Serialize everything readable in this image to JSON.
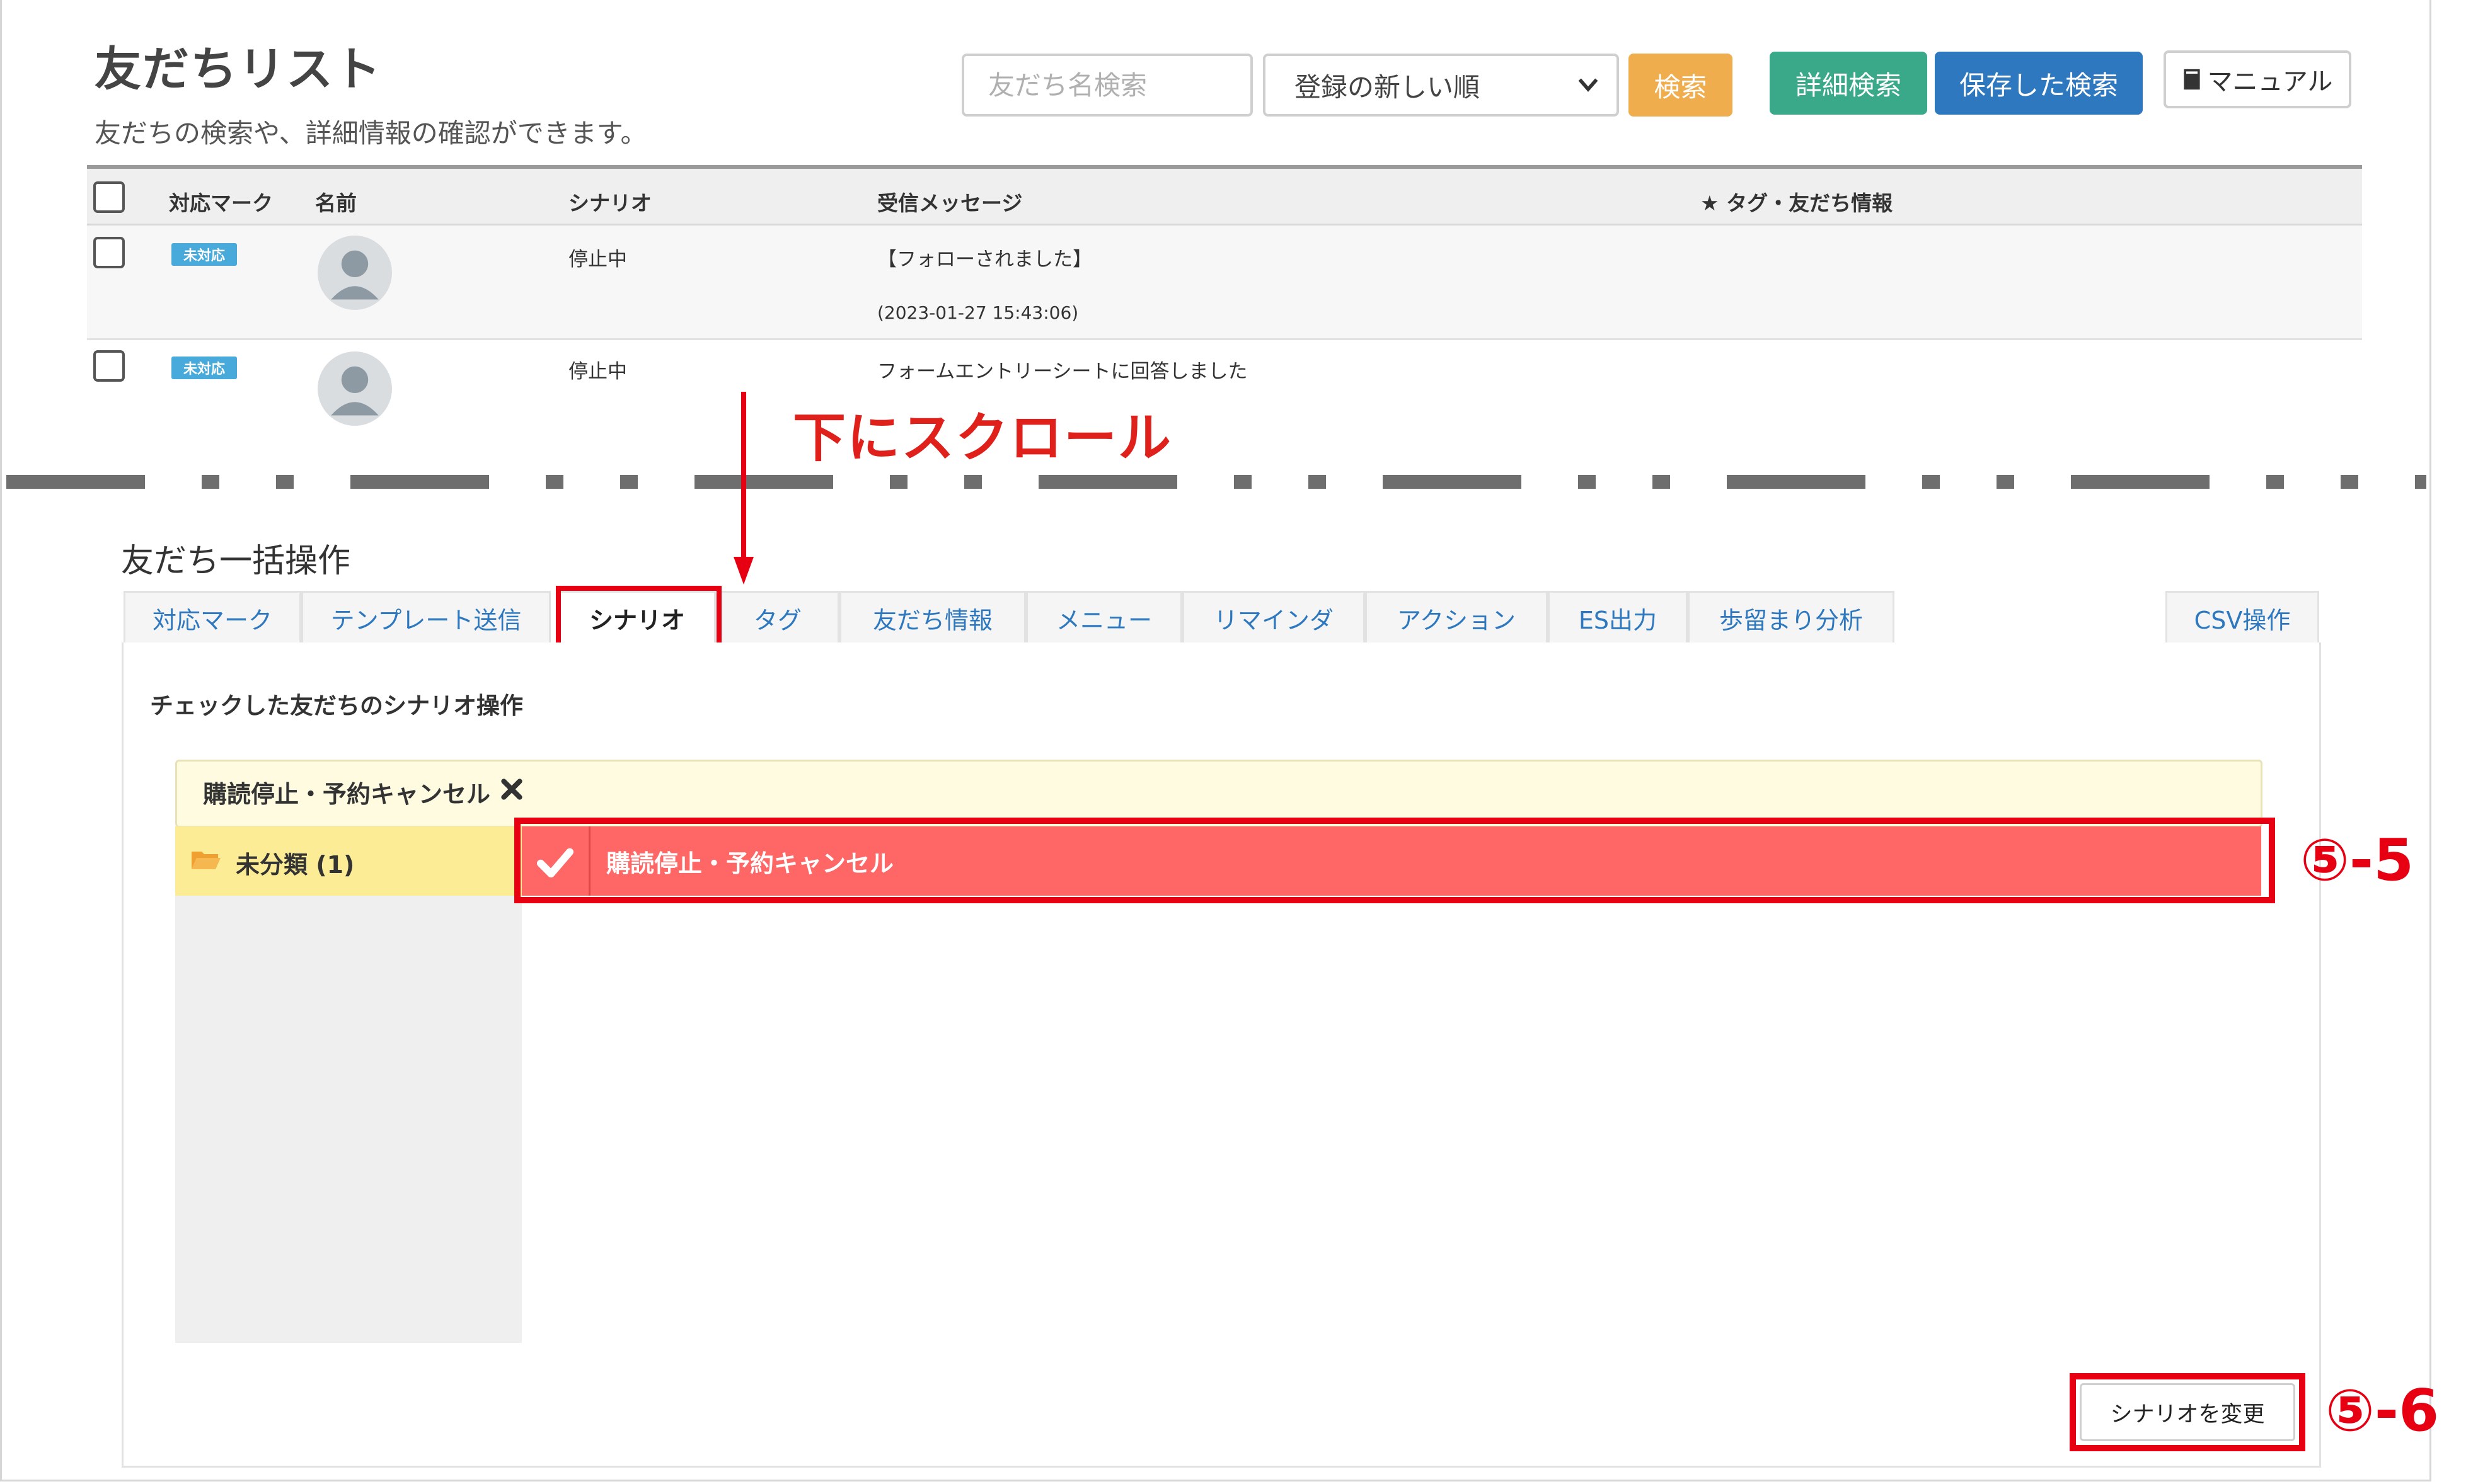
{
  "header": {
    "title": "友だちリスト",
    "subtitle": "友だちの検索や、詳細情報の確認ができます。",
    "search_placeholder": "友だち名検索",
    "sort_selected": "登録の新しい順",
    "search_button": "検索",
    "detail_search_button": "詳細検索",
    "saved_search_button": "保存した検索",
    "manual_button": "マニュアル"
  },
  "table": {
    "columns": [
      "対応マーク",
      "名前",
      "シナリオ",
      "受信メッセージ",
      "★ タグ・友だち情報"
    ],
    "rows": [
      {
        "badge": "未対応",
        "scenario": "停止中",
        "message": "【フォローされました】",
        "timestamp": "(2023-01-27 15:43:06)"
      },
      {
        "badge": "未対応",
        "scenario": "停止中",
        "message": "フォームエントリーシートに回答しました",
        "timestamp": ""
      }
    ]
  },
  "annotation": {
    "scroll_label": "下にスクロール",
    "step_5_5": "⑤-5",
    "step_5_6": "⑤-6",
    "highlight_color": "#e60012"
  },
  "bulk": {
    "title": "友だち一括操作",
    "tabs": [
      "対応マーク",
      "テンプレート送信",
      "シナリオ",
      "タグ",
      "友だち情報",
      "メニュー",
      "リマインダ",
      "アクション",
      "ES出力",
      "歩留まり分析",
      "CSV操作"
    ],
    "active_tab": "シナリオ",
    "panel_heading": "チェックした友だちのシナリオ操作",
    "selected_scenario": "購読停止・予約キャンセル",
    "folder_label": "未分類 (1)",
    "scenario_item": "購読停止・予約キャンセル",
    "change_button": "シナリオを変更"
  }
}
